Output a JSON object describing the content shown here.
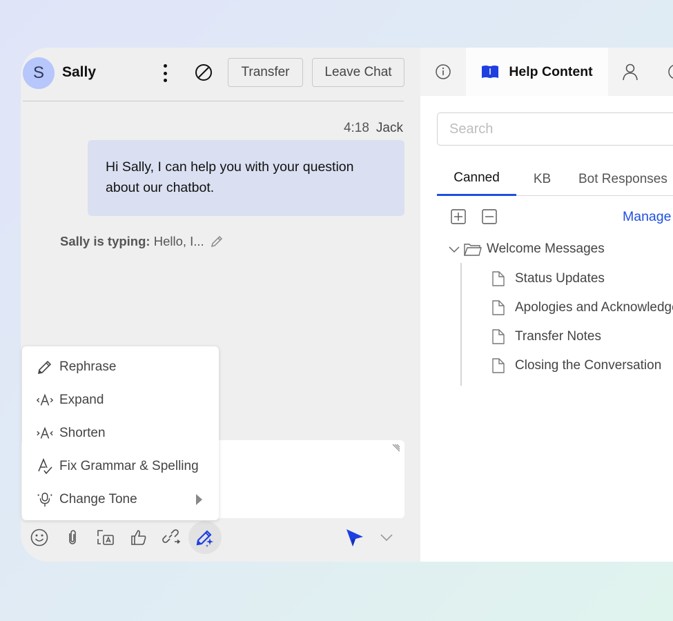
{
  "chat": {
    "contact": {
      "initial": "S",
      "name": "Sally"
    },
    "header_buttons": {
      "transfer": "Transfer",
      "leave": "Leave Chat"
    },
    "message": {
      "time": "4:18",
      "author": "Jack",
      "text": "Hi Sally, I can help you with your question about our chatbot."
    },
    "typing": {
      "label": "Sally is typing:",
      "preview": "Hello, I..."
    },
    "composer": {
      "value": ""
    },
    "ai_menu": [
      {
        "label": "Rephrase",
        "icon": "pencil-icon"
      },
      {
        "label": "Expand",
        "icon": "expand-text-icon"
      },
      {
        "label": "Shorten",
        "icon": "shorten-text-icon"
      },
      {
        "label": "Fix Grammar & Spelling",
        "icon": "spellcheck-icon"
      },
      {
        "label": "Change Tone",
        "icon": "tone-microphone-icon",
        "has_submenu": true
      }
    ],
    "toolbar": [
      "emoji-icon",
      "attachment-icon",
      "translate-icon",
      "thumbs-up-icon",
      "link-transfer-icon",
      "ai-assist-icon"
    ],
    "accent_color": "#1f3fe0"
  },
  "side_panel": {
    "tabs": [
      {
        "label": "",
        "icon": "info-icon"
      },
      {
        "label": "Help Content",
        "icon": "book-icon",
        "active": true
      },
      {
        "label": "",
        "icon": "user-icon"
      },
      {
        "label": "",
        "icon": "more-icon"
      }
    ],
    "search": {
      "placeholder": "Search",
      "value": ""
    },
    "sub_tabs": [
      {
        "label": "Canned",
        "active": true
      },
      {
        "label": "KB"
      },
      {
        "label": "Bot Responses"
      }
    ],
    "manage_label": "Manage",
    "tree": {
      "folder": "Welcome Messages",
      "expanded": true,
      "items": [
        "Status Updates",
        "Apologies and Acknowledgements",
        "Transfer Notes",
        "Closing the Conversation"
      ]
    }
  }
}
